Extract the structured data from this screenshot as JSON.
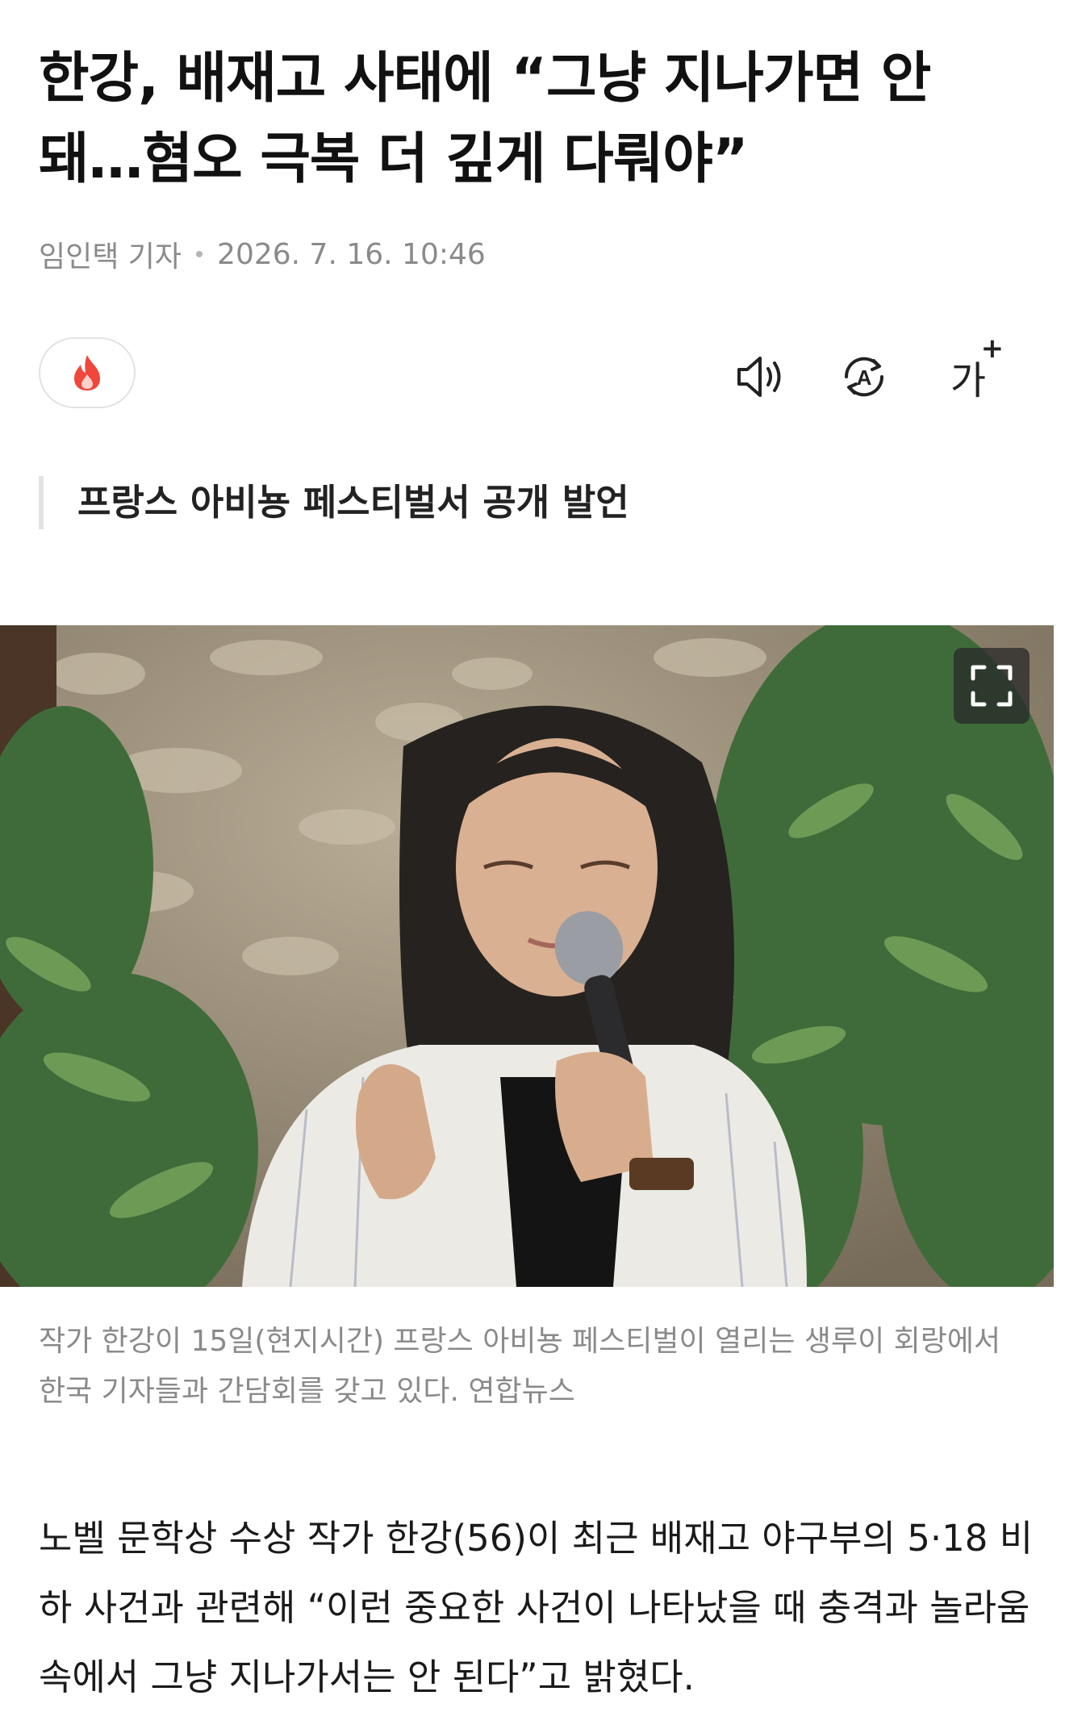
{
  "article": {
    "headline": "한강, 배재고 사태에 “그냥 지나가면 안 돼…혐오 극복 더 깊게 다뤄야”",
    "author": "임인택 기자",
    "date": "2026. 7. 16. 10:46",
    "subheadline": "프랑스 아비뇽 페스티벌서 공개 발언",
    "caption": "작가 한강이 15일(현지시간) 프랑스 아비뇽 페스티벌이 열리는 생루이 회랑에서 한국 기자들과 간담회를 갖고 있다. 연합뉴스",
    "body": "노벨 문학상 수상 작가 한강(56)이 최근 배재고 야구부의 5·18 비하 사건과 관련해 “이런 중요한 사건이 나타났을 때 충격과 놀라움 속에서 그냥 지나가서는 안 된다”고 밝혔다."
  },
  "toolbar": {
    "font_size_label": "가",
    "font_size_plus": "+",
    "translate_letter": "A"
  },
  "icons": {
    "like": "fire-icon",
    "listen": "speaker-icon",
    "translate": "translate-icon",
    "font_size": "font-size-icon",
    "expand": "expand-icon"
  },
  "colors": {
    "accent": "#f0463c",
    "muted_text": "#8a8a8a",
    "border": "#e2e2e2"
  }
}
